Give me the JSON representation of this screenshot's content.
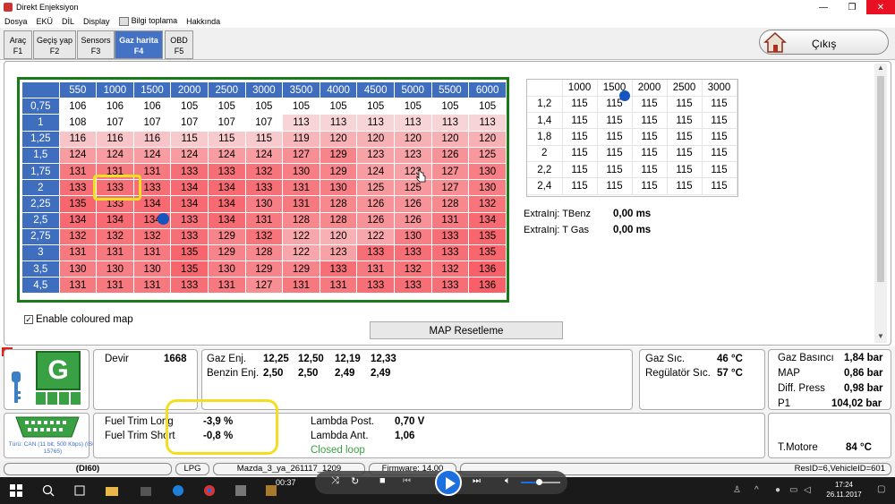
{
  "window": {
    "title": "Direkt Enjeksiyon",
    "minimize": "—",
    "maximize": "❐",
    "close": "✕"
  },
  "menu": {
    "items": [
      "Dosya",
      "EKÜ",
      "DİL",
      "Display"
    ],
    "checkbox_label": "Bilgi toplama",
    "about": "Hakkında"
  },
  "tabs": [
    {
      "label": "Araç",
      "key": "F1"
    },
    {
      "label": "Geçiş yap",
      "key": "F2"
    },
    {
      "label": "Sensors",
      "key": "F3"
    },
    {
      "label": "Gaz harita",
      "key": "F4",
      "active": true
    },
    {
      "label": "OBD",
      "key": "F5"
    }
  ],
  "exit_label": "Çıkış",
  "gas_map": {
    "rpm": [
      "550",
      "1000",
      "1500",
      "2000",
      "2500",
      "3000",
      "3500",
      "4000",
      "4500",
      "5000",
      "5500",
      "6000"
    ],
    "rows": [
      {
        "label": "0,75",
        "values": [
          106,
          106,
          106,
          105,
          105,
          105,
          105,
          105,
          105,
          105,
          105,
          105
        ]
      },
      {
        "label": "1",
        "values": [
          108,
          107,
          107,
          107,
          107,
          107,
          113,
          113,
          113,
          113,
          113,
          113
        ]
      },
      {
        "label": "1,25",
        "values": [
          116,
          116,
          116,
          115,
          115,
          115,
          119,
          120,
          120,
          120,
          120,
          120
        ]
      },
      {
        "label": "1,5",
        "values": [
          124,
          124,
          124,
          124,
          124,
          124,
          127,
          129,
          123,
          123,
          126,
          125
        ]
      },
      {
        "label": "1,75",
        "values": [
          131,
          131,
          131,
          133,
          133,
          132,
          130,
          129,
          124,
          123,
          127,
          130
        ]
      },
      {
        "label": "2",
        "values": [
          133,
          133,
          133,
          134,
          134,
          133,
          131,
          130,
          125,
          125,
          127,
          130
        ]
      },
      {
        "label": "2,25",
        "values": [
          135,
          133,
          134,
          134,
          134,
          130,
          131,
          128,
          126,
          126,
          128,
          132
        ]
      },
      {
        "label": "2,5",
        "values": [
          134,
          134,
          134,
          133,
          134,
          131,
          128,
          128,
          126,
          126,
          131,
          134
        ]
      },
      {
        "label": "2,75",
        "values": [
          132,
          132,
          132,
          133,
          129,
          132,
          122,
          120,
          122,
          130,
          133,
          135
        ]
      },
      {
        "label": "3",
        "values": [
          131,
          131,
          131,
          135,
          129,
          128,
          122,
          123,
          133,
          133,
          133,
          135
        ]
      },
      {
        "label": "3,5",
        "values": [
          130,
          130,
          130,
          135,
          130,
          129,
          129,
          133,
          131,
          132,
          132,
          136
        ]
      },
      {
        "label": "4,5",
        "values": [
          131,
          131,
          131,
          133,
          131,
          127,
          131,
          131,
          133,
          133,
          133,
          136
        ]
      }
    ]
  },
  "side_map": {
    "rpm": [
      "1000",
      "1500",
      "2000",
      "2500",
      "3000"
    ],
    "rows": [
      {
        "label": "1,2",
        "values": [
          115,
          115,
          115,
          115,
          115
        ]
      },
      {
        "label": "1,4",
        "values": [
          115,
          115,
          115,
          115,
          115
        ]
      },
      {
        "label": "1,8",
        "values": [
          115,
          115,
          115,
          115,
          115
        ]
      },
      {
        "label": "2",
        "values": [
          115,
          115,
          115,
          115,
          115
        ]
      },
      {
        "label": "2,2",
        "values": [
          115,
          115,
          115,
          115,
          115
        ]
      },
      {
        "label": "2,4",
        "values": [
          115,
          115,
          115,
          115,
          115
        ]
      }
    ]
  },
  "extra_inj": {
    "tbenz_label": "ExtraInj: TBenz",
    "tbenz_value": "0,00 ms",
    "tgas_label": "ExtraInj: T Gas",
    "tgas_value": "0,00 ms"
  },
  "colour_map_label": "Enable coloured map",
  "reset_label": "MAP Resetleme",
  "bottom": {
    "devir_label": "Devir",
    "devir_value": "1668",
    "gaz_enj_label": "Gaz Enj.",
    "gaz_enj_values": [
      "12,25",
      "12,50",
      "12,19",
      "12,33"
    ],
    "benzin_enj_label": "Benzin Enj.",
    "benzin_enj_values": [
      "2,50",
      "2,50",
      "2,49",
      "2,49"
    ],
    "gaz_sic_label": "Gaz Sıc.",
    "gaz_sic_value": "46 °C",
    "reg_sic_label": "Regülatör Sıc.",
    "reg_sic_value": "57 °C",
    "gaz_basinci_label": "Gaz Basıncı",
    "gaz_basinci_value": "1,84 bar",
    "map_label": "MAP",
    "map_value": "0,86 bar",
    "diff_label": "Diff. Press",
    "diff_value": "0,98 bar",
    "p1_label": "P1",
    "p1_value": "104,02 bar",
    "ftl_label": "Fuel Trim Long",
    "ftl_value": "-3,9 %",
    "fts_label": "Fuel Trim Short",
    "fts_value": "-0,8 %",
    "lpost_label": "Lambda Post.",
    "lpost_value": "0,70 V",
    "lant_label": "Lambda Ant.",
    "lant_value": "1,06",
    "loop_status": "Closed loop",
    "tmotore_label": "T.Motore",
    "tmotore_value": "84 °C",
    "g_letter": "G",
    "obd_text": "Türü: CAN (11 bit, 500 Kbps) (ISO 15765)"
  },
  "status": {
    "device": "(DI60)",
    "fuel": "LPG",
    "file": "Mazda_3_ya_261117_1209",
    "firmware": "Firmware: 14.00",
    "ids": "ResID=6,VehicleID=601"
  },
  "player": {
    "time": "00:37"
  },
  "taskbar": {
    "clock_time": "17:24",
    "clock_date": "26.11.2017"
  },
  "colors": {
    "accent": "#4472c4",
    "frame": "#1a7a1a",
    "highlight": "#f2e020",
    "marker": "#1555c0",
    "status_green": "#3aa044"
  }
}
